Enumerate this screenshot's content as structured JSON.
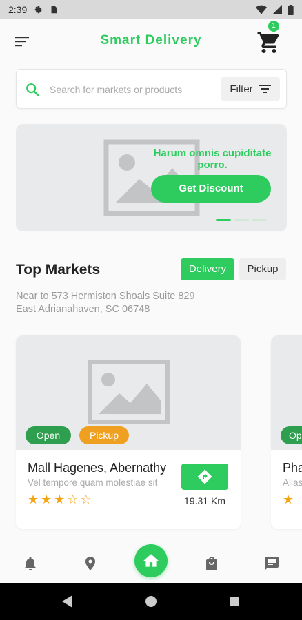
{
  "status_bar": {
    "time": "2:39"
  },
  "app": {
    "title": "Smart Delivery",
    "cart_count": "1"
  },
  "search": {
    "placeholder": "Search for markets or products",
    "filter_label": "Filter"
  },
  "banner": {
    "text": "Harum omnis cupiditate porro.",
    "button_label": "Get Discount",
    "slides": 3,
    "active_slide": 1
  },
  "markets": {
    "title": "Top Markets",
    "tab_delivery": "Delivery",
    "tab_pickup": "Pickup",
    "address_line1": "Near to 573 Hermiston Shoals Suite 829",
    "address_line2": "East Adrianahaven, SC 06748",
    "cards": [
      {
        "status": "Open",
        "mode": "Pickup",
        "name": "Mall Hagenes, Abernathy",
        "description": "Vel tempore quam molestiae sit",
        "rating": 3,
        "max_rating": 5,
        "distance": "19.31 Km"
      },
      {
        "status": "Op",
        "name": "Pha",
        "description": "Alias",
        "rating": 1
      }
    ]
  },
  "colors": {
    "accent": "#2ecc5f",
    "pickup_badge": "#f0a020",
    "open_badge": "#2e9e4f",
    "star": "#f3a412"
  },
  "bottom_nav": {
    "icons": [
      "bell-icon",
      "location-pin-icon",
      "home-icon",
      "shopping-bag-icon",
      "chat-icon"
    ],
    "active": "home-icon"
  }
}
